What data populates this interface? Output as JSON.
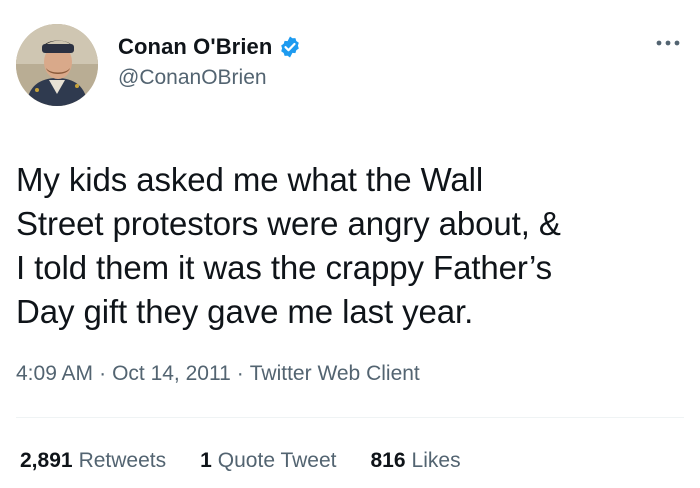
{
  "tweet": {
    "author": {
      "display_name": "Conan O'Brien",
      "handle": "@ConanOBrien",
      "verified": true,
      "verified_color": "#1d9bf0"
    },
    "text": "My kids asked me what the Wall\nStreet protestors were angry about, &\nI told them it was the crappy Father’s\nDay gift they gave me last year.",
    "time": "4:09 AM",
    "date": "Oct 14, 2011",
    "separator": "·",
    "client": "Twitter Web Client",
    "stats": {
      "retweets_count": "2,891",
      "retweets_label": "Retweets",
      "quotes_count": "1",
      "quotes_label": "Quote Tweet",
      "likes_count": "816",
      "likes_label": "Likes"
    }
  },
  "icons": {
    "verified": "verified-badge-icon",
    "more": "more-options-icon"
  }
}
